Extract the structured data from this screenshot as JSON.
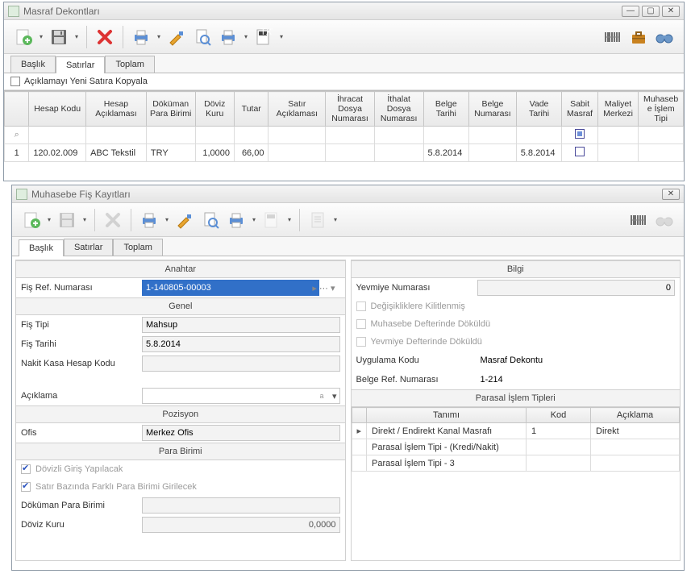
{
  "win1": {
    "title": "Masraf Dekontları",
    "copyLabel": "Açıklamayı Yeni Satıra Kopyala",
    "tabs": [
      "Başlık",
      "Satırlar",
      "Toplam"
    ],
    "activeTab": 1,
    "columns": [
      "",
      "Hesap Kodu",
      "Hesap Açıklaması",
      "Döküman Para Birimi",
      "Döviz Kuru",
      "Tutar",
      "Satır Açıklaması",
      "İhracat Dosya Numarası",
      "İthalat Dosya Numarası",
      "Belge Tarihi",
      "Belge Numarası",
      "Vade Tarihi",
      "Sabit Masraf",
      "Maliyet Merkezi",
      "Muhasebe İşlem Tipi"
    ],
    "rows": [
      {
        "key": "1",
        "hesapKodu": "120.02.009",
        "hesapAciklama": "ABC Tekstil",
        "paraBirimi": "TRY",
        "dovizKuru": "1,0000",
        "tutar": "66,00",
        "satirAciklama": "",
        "ihracat": "",
        "ithalat": "",
        "belgeTarihi": "5.8.2014",
        "belgeNumarasi": "",
        "vadeTarihi": "5.8.2014",
        "sabitMasraf": false,
        "maliyetMerkezi": "",
        "islemTipi": ""
      }
    ]
  },
  "win2": {
    "title": "Muhasebe Fiş Kayıtları",
    "tabs": [
      "Başlık",
      "Satırlar",
      "Toplam"
    ],
    "activeTab": 0,
    "sections": {
      "anahtar": "Anahtar",
      "genel": "Genel",
      "pozisyon": "Pozisyon",
      "paraBirimi": "Para Birimi",
      "bilgi": "Bilgi",
      "parasalTipler": "Parasal İşlem Tipleri"
    },
    "labels": {
      "fisRefNo": "Fiş Ref. Numarası",
      "fisTipi": "Fiş Tipi",
      "fisTarihi": "Fiş Tarihi",
      "nakitKasa": "Nakit Kasa Hesap Kodu",
      "aciklama": "Açıklama",
      "ofis": "Ofis",
      "dovizliGiris": "Dövizli Giriş Yapılacak",
      "satirBazinda": "Satır Bazında Farklı Para Birimi Girilecek",
      "dokumanPara": "Döküman Para Birimi",
      "dovizKuru": "Döviz Kuru",
      "yevmiyeNo": "Yevmiye Numarası",
      "degisiklikKilit": "Değişikliklere Kilitlenmiş",
      "muhasebeDokuldu": "Muhasebe Defterinde Döküldü",
      "yevmiyeDokuldu": "Yevmiye Defterinde Döküldü",
      "uygulamaKodu": "Uygulama Kodu",
      "belgeRefNo": "Belge Ref. Numarası"
    },
    "values": {
      "fisRefNo": "1-140805-00003",
      "fisTipi": "Mahsup",
      "fisTarihi": "5.8.2014",
      "nakitKasa": "",
      "aciklama": "",
      "ofis": "Merkez Ofis",
      "dokumanPara": "",
      "dovizKuru": "0,0000",
      "yevmiyeNo": "0",
      "uygulamaKodu": "Masraf Dekontu",
      "belgeRefNo": "1-214"
    },
    "parasalCols": [
      "Tanımı",
      "Kod",
      "Açıklama"
    ],
    "parasalRows": [
      {
        "tanimi": "Direkt / Endirekt Kanal Masrafı",
        "kod": "1",
        "aciklama": "Direkt",
        "current": true
      },
      {
        "tanimi": "Parasal İşlem Tipi - (Kredi/Nakit)",
        "kod": "",
        "aciklama": "",
        "current": false
      },
      {
        "tanimi": "Parasal İşlem Tipi - 3",
        "kod": "",
        "aciklama": "",
        "current": false
      }
    ]
  }
}
